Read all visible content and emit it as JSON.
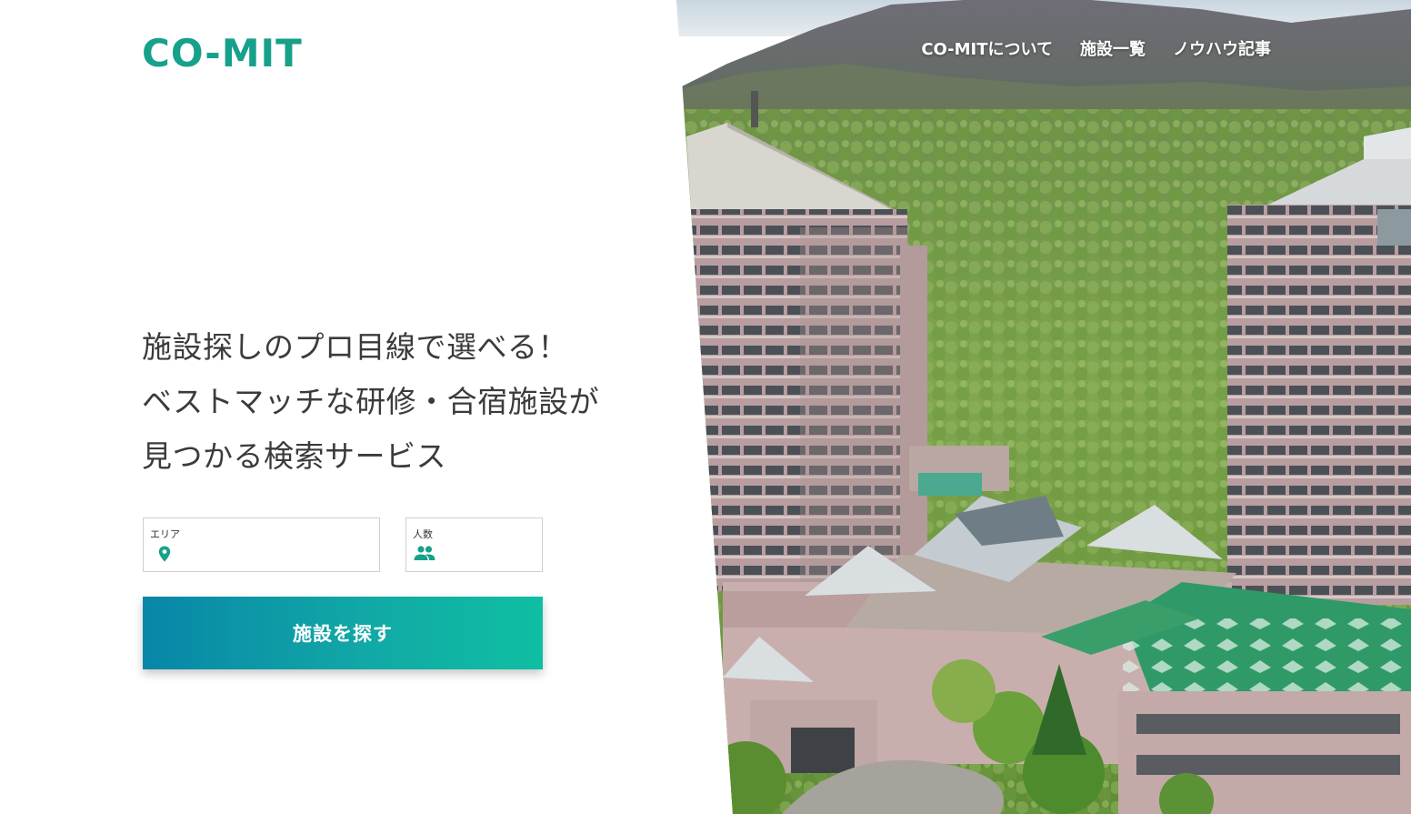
{
  "brand": {
    "logo_text": "CO-MIT",
    "logo_alt": "CO-MIT",
    "color": "#17a08a"
  },
  "nav": {
    "items": [
      {
        "label": "CO-MITについて"
      },
      {
        "label": "施設一覧"
      },
      {
        "label": "ノウハウ記事"
      }
    ]
  },
  "hero": {
    "headline_lines": [
      "施設探しのプロ目線で選べる！",
      "ベストマッチな研修・合宿施設が",
      "見つかる検索サービス"
    ],
    "photo_subject": "mountain-resort-hotel"
  },
  "search": {
    "area_label": "エリア",
    "area_value": "",
    "area_icon": "map-pin-icon",
    "people_label": "人数",
    "people_value": "",
    "people_icon": "people-icon",
    "button_label": "施設を探す",
    "button_gradient": [
      "#0886a8",
      "#0fbfa2"
    ],
    "icon_color": "#17a08a"
  }
}
